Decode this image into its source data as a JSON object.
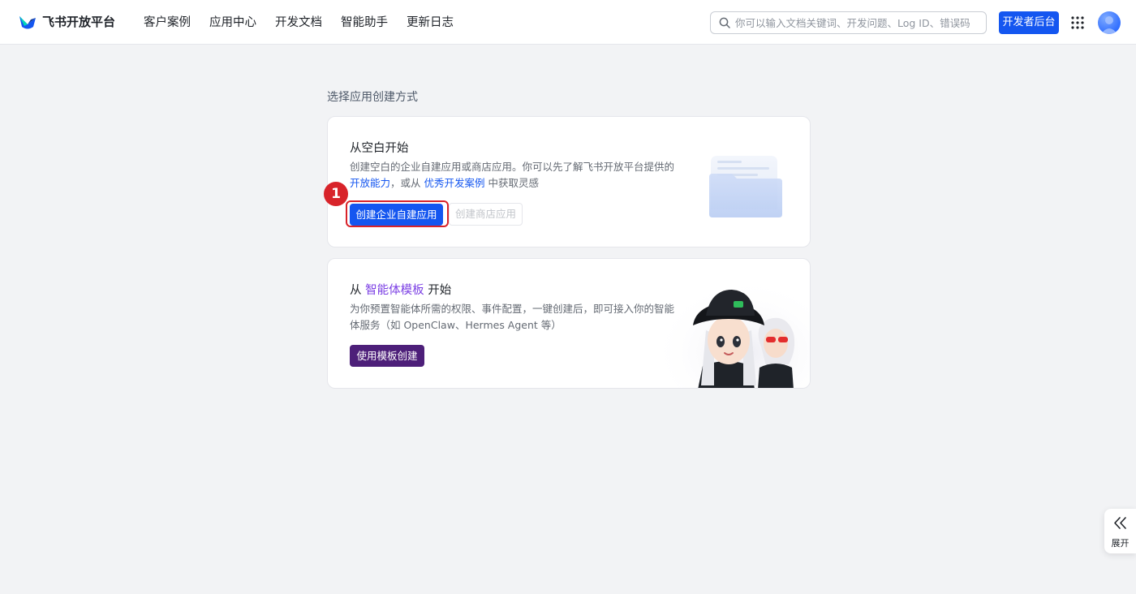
{
  "brand": {
    "name": "飞书开放平台"
  },
  "nav": {
    "items": [
      "客户案例",
      "应用中心",
      "开发文档",
      "智能助手",
      "更新日志"
    ]
  },
  "search": {
    "placeholder": "你可以输入文档关键词、开发问题、Log ID、错误码",
    "value": ""
  },
  "header": {
    "dev_console_label": "开发者后台"
  },
  "page": {
    "section_title": "选择应用创建方式"
  },
  "card_blank": {
    "title": "从空白开始",
    "desc_pre": "创建空白的企业自建应用或商店应用。你可以先了解飞书开放平台提供的 ",
    "link1": "开放能力",
    "desc_mid": "，或从 ",
    "link2": "优秀开发案例",
    "desc_post": " 中获取灵感",
    "primary_btn": "创建企业自建应用",
    "secondary_btn": "创建商店应用"
  },
  "card_template": {
    "title_pre": "从 ",
    "title_highlight": "智能体模板",
    "title_post": " 开始",
    "desc": "为你预置智能体所需的权限、事件配置，一键创建后，即可接入你的智能体服务（如 OpenClaw、Hermes Agent 等）",
    "btn": "使用模板创建"
  },
  "annotation": {
    "step": "1"
  },
  "side_tab": {
    "label": "展开"
  },
  "colors": {
    "primary": "#1456f0",
    "purple": "#4d1f79",
    "highlight": "#7b3fe4",
    "annotation": "#d8232a",
    "background": "#f2f3f5"
  }
}
